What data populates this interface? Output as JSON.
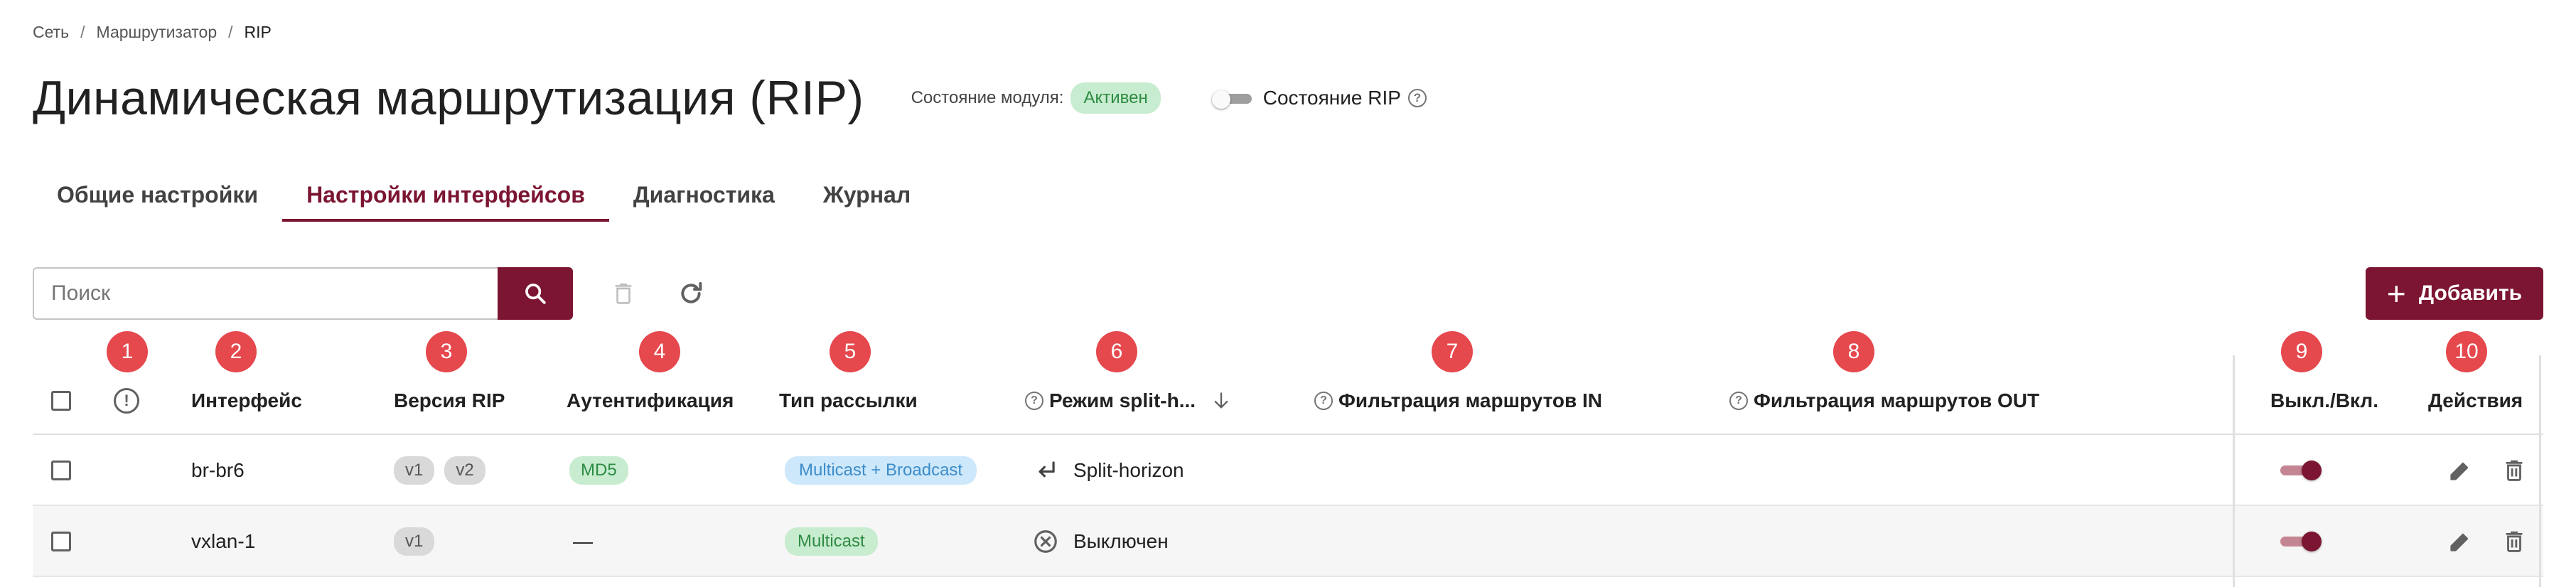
{
  "breadcrumb": {
    "items": [
      "Сеть",
      "Маршрутизатор",
      "RIP"
    ],
    "separator": "/"
  },
  "header": {
    "title": "Динамическая маршрутизация (RIP)",
    "module_state_label": "Состояние модуля:",
    "module_state_value": "Активен",
    "rip_state_label": "Состояние RIP",
    "rip_state_enabled": false
  },
  "tabs": [
    {
      "label": "Общие настройки",
      "active": false
    },
    {
      "label": "Настройки интерфейсов",
      "active": true
    },
    {
      "label": "Диагностика",
      "active": false
    },
    {
      "label": "Журнал",
      "active": false
    }
  ],
  "toolbar": {
    "search_placeholder": "Поиск",
    "add_label": "Добавить"
  },
  "markers": [
    "1",
    "2",
    "3",
    "4",
    "5",
    "6",
    "7",
    "8",
    "9",
    "10"
  ],
  "table": {
    "columns": {
      "status": "!",
      "interface": "Интерфейс",
      "rip_version": "Версия RIP",
      "auth": "Аутентификация",
      "mailing_type": "Тип рассылки",
      "split_mode": "Режим split-h...",
      "filter_in": "Фильтрация маршрутов IN",
      "filter_out": "Фильтрация маршрутов OUT",
      "enabled": "Выкл./Вкл.",
      "actions": "Действия"
    },
    "rows": [
      {
        "interface": "br-br6",
        "versions": [
          "v1",
          "v2"
        ],
        "auth": "MD5",
        "mailing": "Multicast + Broadcast",
        "split_icon": "return-arrow-icon",
        "split": "Split-horizon",
        "enabled": true
      },
      {
        "interface": "vxlan-1",
        "versions": [
          "v1"
        ],
        "auth": "—",
        "mailing": "Multicast",
        "split_icon": "circle-x-icon",
        "split": "Выключен",
        "enabled": true
      }
    ]
  },
  "colors": {
    "accent": "#7b1531",
    "marker": "#e5484d",
    "success_bg": "#c8ecd0",
    "info_bg": "#cde8fb"
  }
}
